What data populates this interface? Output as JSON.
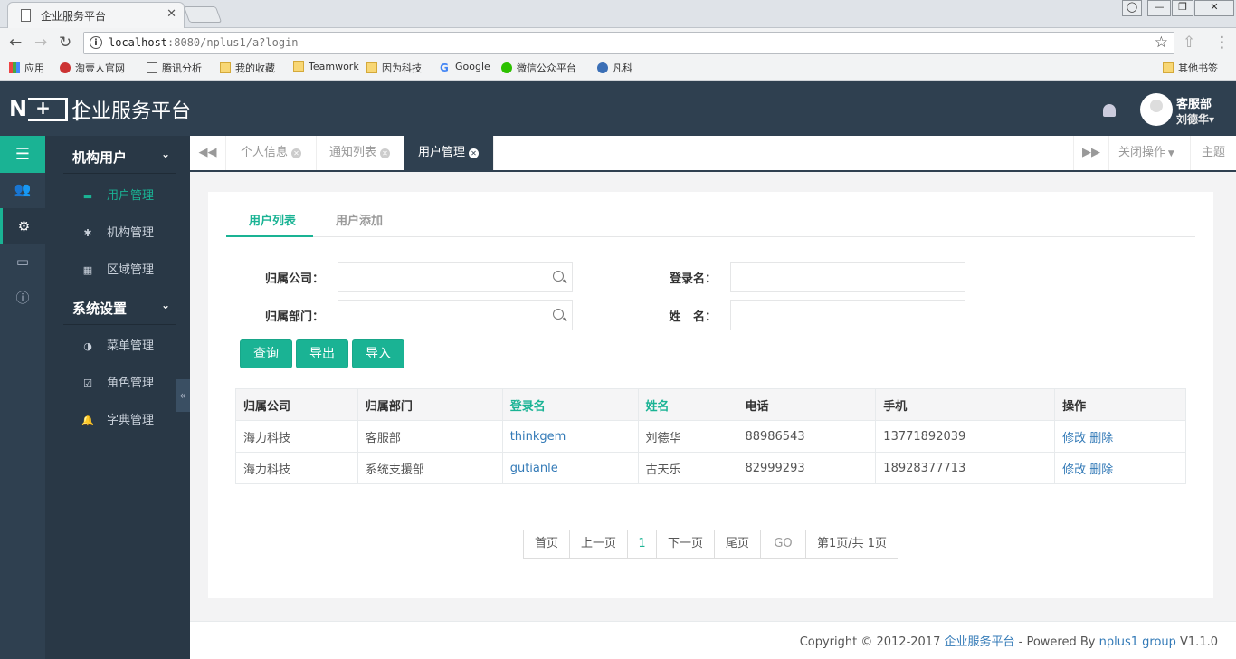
{
  "browser": {
    "tab_title": "企业服务平台",
    "url_host": "localhost",
    "url_rest": ":8080/nplus1/a?login",
    "bookmarks": [
      "应用",
      "淘壹人官网",
      "腾讯分析",
      "我的收藏",
      "Teamwork",
      "因为科技",
      "Google",
      "微信公众平台",
      "凡科"
    ],
    "other_bookmarks": "其他书签"
  },
  "header": {
    "logo": "N+1",
    "title": "企业服务平台",
    "dept": "客服部",
    "user": "刘德华"
  },
  "sidebar": {
    "groups": [
      {
        "label": "机构用户",
        "items": [
          {
            "label": "用户管理",
            "icon": "id-card-icon",
            "active": true
          },
          {
            "label": "机构管理",
            "icon": "gear-icon"
          },
          {
            "label": "区域管理",
            "icon": "grid-icon"
          }
        ]
      },
      {
        "label": "系统设置",
        "items": [
          {
            "label": "菜单管理",
            "icon": "half-circle-icon"
          },
          {
            "label": "角色管理",
            "icon": "checkbox-icon"
          },
          {
            "label": "字典管理",
            "icon": "bell-icon"
          }
        ]
      }
    ]
  },
  "content_tabs": {
    "items": [
      {
        "label": "个人信息"
      },
      {
        "label": "通知列表"
      },
      {
        "label": "用户管理",
        "active": true
      }
    ],
    "close_ops": "关闭操作",
    "theme": "主题"
  },
  "panel": {
    "tabs": [
      {
        "label": "用户列表",
        "active": true
      },
      {
        "label": "用户添加"
      }
    ],
    "form": {
      "company_label": "归属公司：",
      "dept_label": "归属部门：",
      "login_label": "登录名：",
      "name_label": "姓   名：",
      "company": "",
      "dept": "",
      "login": "",
      "name": ""
    },
    "buttons": {
      "query": "查询",
      "export": "导出",
      "import": "导入"
    },
    "table": {
      "headers": [
        "归属公司",
        "归属部门",
        "登录名",
        "姓名",
        "电话",
        "手机",
        "操作"
      ],
      "rows": [
        [
          "海力科技",
          "客服部",
          "thinkgem",
          "刘德华",
          "88986543",
          "13771892039"
        ],
        [
          "海力科技",
          "系统支援部",
          "gutianle",
          "古天乐",
          "82999293",
          "18928377713"
        ]
      ],
      "edit": "修改",
      "delete": "删除"
    },
    "pager": {
      "first": "首页",
      "prev": "上一页",
      "current": "1",
      "next": "下一页",
      "last": "尾页",
      "go": "GO",
      "info": "第1页/共 1页"
    }
  },
  "footer": {
    "copyright": "Copyright © 2012-2017 ",
    "platform": "企业服务平台",
    "powered": " - Powered By ",
    "product": "nplus1 group",
    "version": " V1.1.0"
  },
  "colors": {
    "accent": "#1ab394",
    "nav_dark": "#2f4050",
    "link": "#337ab7"
  }
}
